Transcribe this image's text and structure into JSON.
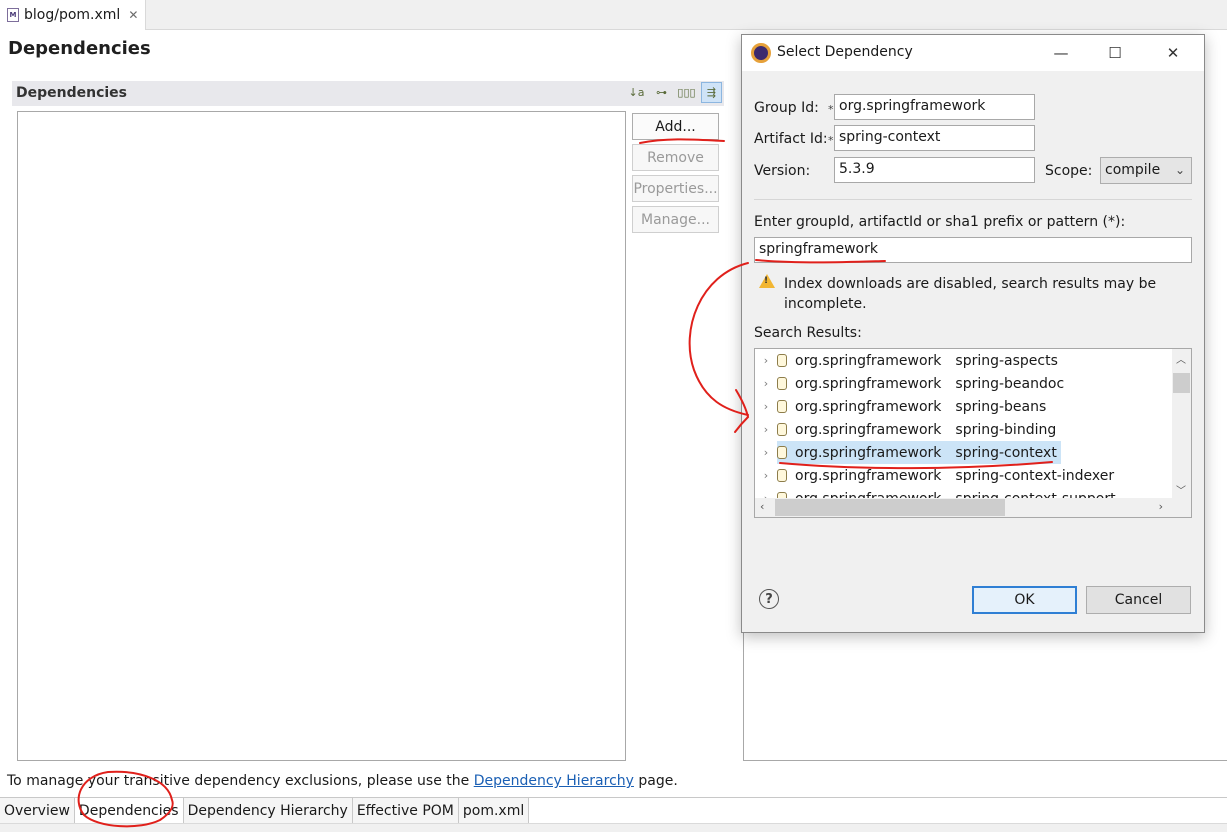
{
  "editor": {
    "tab_label": "blog/pom.xml",
    "tab_close": "✕",
    "file_icon_text": "M",
    "page_title": "Dependencies"
  },
  "section": {
    "title": "Dependencies",
    "tools": [
      {
        "icon": "sort-az-icon",
        "glyph": "↓a"
      },
      {
        "icon": "hierarchy-icon",
        "glyph": "⊶"
      },
      {
        "icon": "columns-icon",
        "glyph": "▯▯▯"
      },
      {
        "icon": "filter-toggle-icon",
        "glyph": "⇶"
      }
    ]
  },
  "buttons": {
    "add": "Add...",
    "remove": "Remove",
    "properties": "Properties...",
    "manage": "Manage..."
  },
  "footer": {
    "prefix": "To manage your transitive dependency exclusions, please use the ",
    "link": "Dependency Hierarchy",
    "suffix": " page."
  },
  "bottom_tabs": [
    {
      "label": "Overview"
    },
    {
      "label": "Dependencies",
      "active": true
    },
    {
      "label": "Dependency Hierarchy"
    },
    {
      "label": "Effective POM"
    },
    {
      "label": "pom.xml"
    }
  ],
  "dialog": {
    "title": "Select Dependency",
    "group_id_label": "Group Id:",
    "group_id_value": "org.springframework",
    "artifact_id_label": "Artifact Id:",
    "artifact_id_value": "spring-context",
    "required_marker": "*",
    "version_label": "Version:",
    "version_value": "5.3.9",
    "scope_label": "Scope:",
    "scope_value": "compile",
    "search_label": "Enter groupId, artifactId or sha1 prefix or pattern (*):",
    "search_value": "springframework",
    "warning": "Index downloads are disabled, search results may be incomplete.",
    "results_label": "Search Results:",
    "results": [
      {
        "group": "org.springframework",
        "artifact": "spring-aspects"
      },
      {
        "group": "org.springframework",
        "artifact": "spring-beandoc"
      },
      {
        "group": "org.springframework",
        "artifact": "spring-beans"
      },
      {
        "group": "org.springframework",
        "artifact": "spring-binding"
      },
      {
        "group": "org.springframework",
        "artifact": "spring-context",
        "selected": true
      },
      {
        "group": "org.springframework",
        "artifact": "spring-context-indexer"
      },
      {
        "group": "org.springframework",
        "artifact": "spring-context-support"
      }
    ],
    "ok": "OK",
    "cancel": "Cancel",
    "help": "?"
  },
  "colors": {
    "annotation": "#e0201b",
    "selection": "#cce4f7",
    "link": "#1a5fb4",
    "default_button_border": "#2f7fd4"
  }
}
